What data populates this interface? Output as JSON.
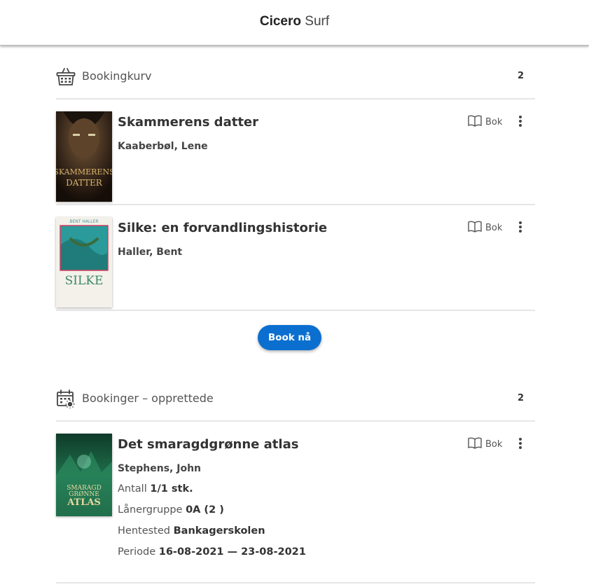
{
  "app": {
    "title_bold": "Cicero",
    "title_light": "Surf"
  },
  "basket": {
    "title": "Bookingkurv",
    "count": "2",
    "items": [
      {
        "title": "Skammerens datter",
        "author": "Kaaberbøl, Lene",
        "type": "Bok",
        "cover_text": [
          "SKAMMERENS",
          "DATTER"
        ]
      },
      {
        "title": "Silke: en forvandlingshistorie",
        "author": "Haller, Bent",
        "type": "Bok",
        "cover_text": [
          "SILKE"
        ]
      }
    ],
    "book_button": "Book nå"
  },
  "bookings": {
    "title": "Bookinger – opprettede",
    "count": "2",
    "items": [
      {
        "title": "Det smaragdgrønne atlas",
        "author": "Stephens, John",
        "type": "Bok",
        "cover_text": [
          "SMARAGD",
          "GRØNNE",
          "ATLAS"
        ],
        "antall_label": "Antall",
        "antall_value": "1/1 stk.",
        "gruppe_label": "Lånergruppe",
        "gruppe_value": "0A (2 )",
        "hentested_label": "Hentested",
        "hentested_value": "Bankagerskolen",
        "periode_label": "Periode",
        "periode_value": "16-08-2021 — 23-08-2021"
      }
    ]
  },
  "colors": {
    "accent": "#0b6fd0",
    "divider": "#e6e6e6",
    "text": "#333333"
  }
}
